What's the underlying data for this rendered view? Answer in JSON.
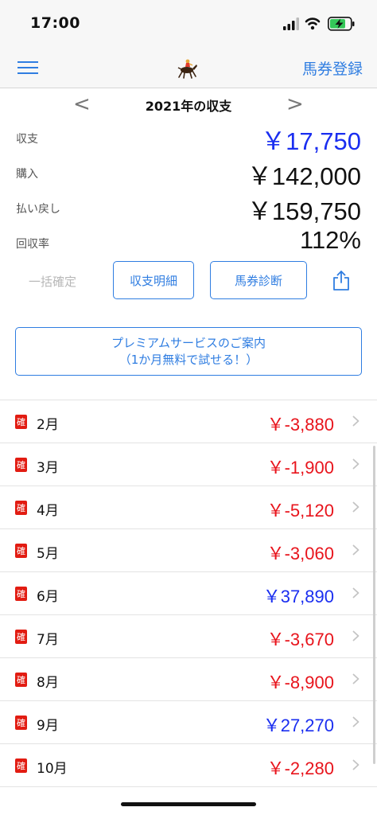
{
  "status_bar": {
    "time": "17:00"
  },
  "nav": {
    "register_label": "馬券登録",
    "menu_icon": "hamburger-icon",
    "logo_icon": "jockey-horse-icon"
  },
  "year": {
    "title": "2021年の収支",
    "prev": "<",
    "next": ">"
  },
  "summary": [
    {
      "label": "収支",
      "value": "￥17,750",
      "color": "#1a2ef0"
    },
    {
      "label": "購入",
      "value": "￥142,000",
      "color": "#111111"
    },
    {
      "label": "払い戻し",
      "value": "￥159,750",
      "color": "#111111"
    },
    {
      "label": "回収率",
      "value": "112%",
      "color": "#111111"
    }
  ],
  "actions": {
    "confirm_all": "一括確定",
    "detail_button": "収支明細",
    "diagnosis_button": "馬券診断",
    "share_icon": "share-icon"
  },
  "premium": {
    "line1": "プレミアムサービスのご案内",
    "line2": "（1か月無料で試せる！）"
  },
  "badge_label": "確",
  "colors": {
    "accent": "#2f7de1",
    "negative": "#e8141c",
    "positive": "#1a2ef0",
    "badge": "#e21c12"
  },
  "months": [
    {
      "month": "2月",
      "amount": "￥-3,880",
      "sign": "negative"
    },
    {
      "month": "3月",
      "amount": "￥-1,900",
      "sign": "negative"
    },
    {
      "month": "4月",
      "amount": "￥-5,120",
      "sign": "negative"
    },
    {
      "month": "5月",
      "amount": "￥-3,060",
      "sign": "negative"
    },
    {
      "month": "6月",
      "amount": "￥37,890",
      "sign": "positive"
    },
    {
      "month": "7月",
      "amount": "￥-3,670",
      "sign": "negative"
    },
    {
      "month": "8月",
      "amount": "￥-8,900",
      "sign": "negative"
    },
    {
      "month": "9月",
      "amount": "￥27,270",
      "sign": "positive"
    },
    {
      "month": "10月",
      "amount": "￥-2,280",
      "sign": "negative"
    }
  ]
}
